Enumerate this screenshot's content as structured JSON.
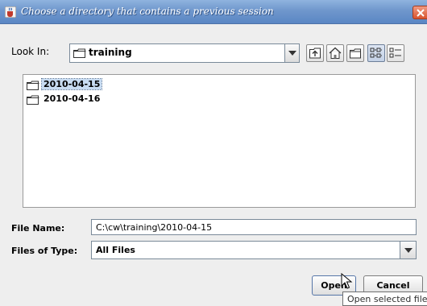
{
  "window": {
    "title": "Choose a directory that contains a previous session",
    "app_icon": "java-cup-icon",
    "close_icon": "close-icon"
  },
  "look_in": {
    "label": "Look In:",
    "value": "training",
    "toolbar": [
      {
        "name": "up-one-level-icon"
      },
      {
        "name": "home-icon"
      },
      {
        "name": "create-new-folder-icon"
      },
      {
        "name": "list-view-icon"
      },
      {
        "name": "details-view-icon"
      }
    ]
  },
  "file_list": {
    "items": [
      {
        "label": "2010-04-15",
        "selected": true
      },
      {
        "label": "2010-04-16",
        "selected": false
      }
    ]
  },
  "file_name": {
    "label": "File Name:",
    "value": "C:\\cw\\training\\2010-04-15"
  },
  "file_type": {
    "label": "Files of Type:",
    "value": "All Files"
  },
  "buttons": {
    "open": "Open",
    "cancel": "Cancel"
  },
  "tooltip": "Open selected file",
  "colors": {
    "titlebar": "#6f97cc",
    "close": "#d9542f",
    "selection": "#c8dcf2"
  }
}
